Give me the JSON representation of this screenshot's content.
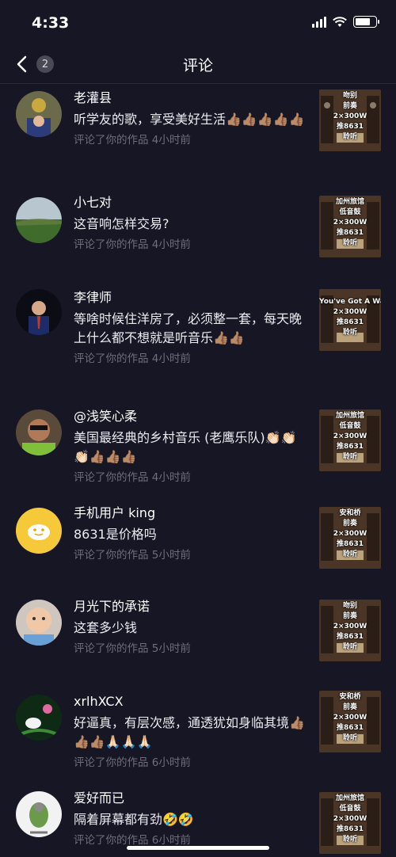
{
  "status": {
    "time": "4:33",
    "battery_level": 0.75
  },
  "nav": {
    "title": "评论",
    "back_count": "2"
  },
  "comments": [
    {
      "user": "老灌县",
      "text": "听学友的歌，享受美好生活👍🏽👍🏽👍🏽👍🏽👍🏽",
      "meta": "评论了你的作品 4小时前",
      "thumb": [
        "吻别",
        "前奏",
        "2×300W",
        "推8631",
        "聆听"
      ]
    },
    {
      "user": "小七对",
      "text": "这音响怎样交易?",
      "meta": "评论了你的作品 4小时前",
      "thumb": [
        "加州旅馆",
        "低音鼓",
        "2×300W",
        "推8631",
        "聆听"
      ]
    },
    {
      "user": "李律师",
      "text": "等啥时候住洋房了，必须整一套，每天晚上什么都不想就是听音乐👍🏽👍🏽",
      "meta": "评论了你的作品 4小时前",
      "thumb": [
        "You've Got A Way",
        "2×300W",
        "推8631",
        "聆听"
      ]
    },
    {
      "user": "@浅笑心柔",
      "text": "美国最经典的乡村音乐 (老鹰乐队)👏🏻👏🏻👏🏻👍🏽👍🏽👍🏽",
      "meta": "评论了你的作品 4小时前",
      "thumb": [
        "加州旅馆",
        "低音鼓",
        "2×300W",
        "推8631",
        "聆听"
      ]
    },
    {
      "user": "手机用户 king",
      "text": "8631是价格吗",
      "meta": "评论了你的作品 5小时前",
      "thumb": [
        "安和桥",
        "前奏",
        "2×300W",
        "推8631",
        "聆听"
      ]
    },
    {
      "user": "月光下的承诺",
      "text": "这套多少钱",
      "meta": "评论了你的作品 5小时前",
      "thumb": [
        "吻别",
        "前奏",
        "2×300W",
        "推8631",
        "聆听"
      ]
    },
    {
      "user": "xrlhXCX",
      "text": "好逼真，有层次感，通透犹如身临其境👍🏽👍🏽👍🏽🙏🏻🙏🏻🙏🏻",
      "meta": "评论了你的作品 6小时前",
      "thumb": [
        "安和桥",
        "前奏",
        "2×300W",
        "推8631",
        "聆听"
      ]
    },
    {
      "user": "爱好而已",
      "text": "隔着屏幕都有劲🤣🤣",
      "meta": "评论了你的作品 6小时前",
      "thumb": [
        "加州旅馆",
        "低音鼓",
        "2×300W",
        "推8631",
        "聆听"
      ]
    }
  ]
}
